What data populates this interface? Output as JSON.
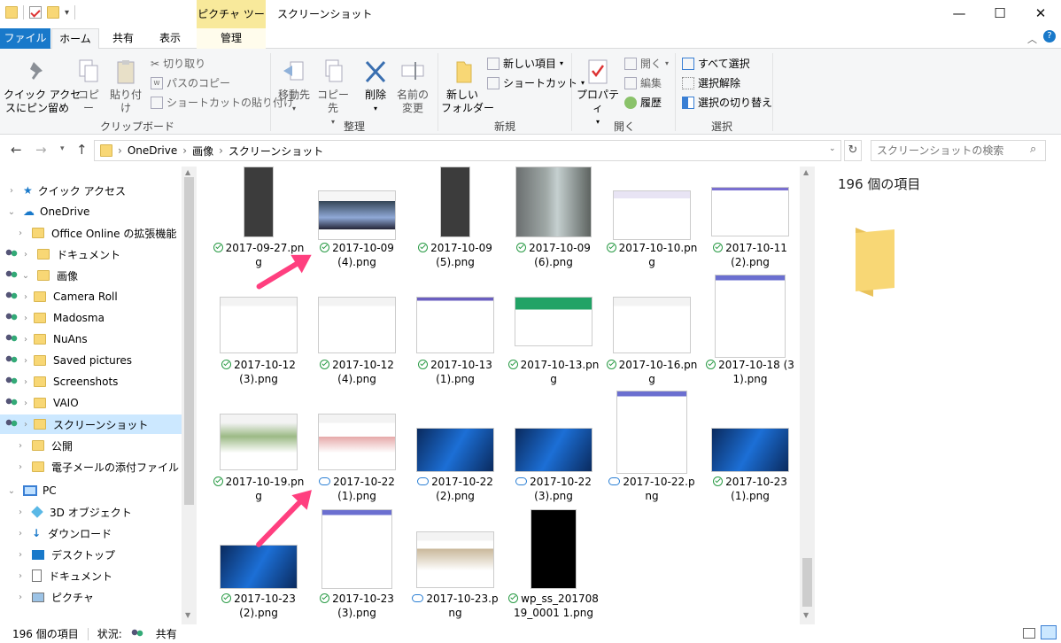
{
  "window": {
    "title": "スクリーンショット",
    "context_tab": "ピクチャ ツール",
    "controls": [
      "—",
      "☐",
      "✕"
    ]
  },
  "tabs": [
    "ファイル",
    "ホーム",
    "共有",
    "表示",
    "管理"
  ],
  "ribbon": {
    "pin": "クイック アクセ\nスにピン留め",
    "copy": "コピー",
    "paste": "貼り付け",
    "cut": "切り取り",
    "copy_path": "パスのコピー",
    "paste_shortcut": "ショートカットの貼り付け",
    "group_clipboard": "クリップボード",
    "move_to": "移動先",
    "copy_to": "コピー先",
    "delete": "削除",
    "rename": "名前の\n変更",
    "group_organize": "整理",
    "new_folder": "新しい\nフォルダー",
    "new_item": "新しい項目",
    "shortcut": "ショートカット",
    "group_new": "新規",
    "properties": "プロパティ",
    "open": "開く",
    "edit": "編集",
    "history": "履歴",
    "group_open": "開く",
    "select_all": "すべて選択",
    "select_none": "選択解除",
    "invert": "選択の切り替え",
    "group_select": "選択"
  },
  "address": {
    "crumbs": [
      "OneDrive",
      "画像",
      "スクリーンショット"
    ],
    "search_placeholder": "スクリーンショットの検索"
  },
  "sidebar": [
    {
      "label": "クイック アクセス",
      "level": 0,
      "chev": "›"
    },
    {
      "label": "OneDrive",
      "level": 0,
      "chev": "⌄"
    },
    {
      "label": "Office Online の拡張機能",
      "level": 1,
      "chev": "›"
    },
    {
      "label": "ドキュメント",
      "level": 1,
      "chev": "›"
    },
    {
      "label": "画像",
      "level": 1,
      "chev": "⌄"
    },
    {
      "label": "Camera Roll",
      "level": 2,
      "chev": "›"
    },
    {
      "label": "Madosma",
      "level": 2,
      "chev": "›"
    },
    {
      "label": "NuAns",
      "level": 2,
      "chev": "›"
    },
    {
      "label": "Saved pictures",
      "level": 2,
      "chev": "›"
    },
    {
      "label": "Screenshots",
      "level": 2,
      "chev": "›"
    },
    {
      "label": "VAIO",
      "level": 2,
      "chev": "›"
    },
    {
      "label": "スクリーンショット",
      "level": 2,
      "chev": "›"
    },
    {
      "label": "公開",
      "level": 1,
      "chev": "›"
    },
    {
      "label": "電子メールの添付ファイル",
      "level": 1,
      "chev": "›"
    },
    {
      "label": "PC",
      "level": 0,
      "chev": "⌄"
    },
    {
      "label": "3D オブジェクト",
      "level": 1,
      "chev": "›"
    },
    {
      "label": "ダウンロード",
      "level": 1,
      "chev": "›"
    },
    {
      "label": "デスクトップ",
      "level": 1,
      "chev": "›"
    },
    {
      "label": "ドキュメント",
      "level": 1,
      "chev": "›"
    },
    {
      "label": "ピクチャ",
      "level": 1,
      "chev": "›"
    }
  ],
  "files": [
    {
      "name": "2017-09-27.png",
      "status": "synced"
    },
    {
      "name": "2017-10-09 (4).png",
      "status": "synced"
    },
    {
      "name": "2017-10-09 (5).png",
      "status": "synced"
    },
    {
      "name": "2017-10-09 (6).png",
      "status": "synced"
    },
    {
      "name": "2017-10-10.png",
      "status": "synced"
    },
    {
      "name": "2017-10-11 (2).png",
      "status": "synced"
    },
    {
      "name": "2017-10-12 (3).png",
      "status": "synced"
    },
    {
      "name": "2017-10-12 (4).png",
      "status": "synced"
    },
    {
      "name": "2017-10-13 (1).png",
      "status": "synced"
    },
    {
      "name": "2017-10-13.png",
      "status": "synced"
    },
    {
      "name": "2017-10-16.png",
      "status": "synced"
    },
    {
      "name": "2017-10-18 (31).png",
      "status": "synced"
    },
    {
      "name": "2017-10-19.png",
      "status": "synced"
    },
    {
      "name": "2017-10-22 (1).png",
      "status": "cloud"
    },
    {
      "name": "2017-10-22 (2).png",
      "status": "cloud"
    },
    {
      "name": "2017-10-22 (3).png",
      "status": "cloud"
    },
    {
      "name": "2017-10-22.png",
      "status": "cloud"
    },
    {
      "name": "2017-10-23 (1).png",
      "status": "synced"
    },
    {
      "name": "2017-10-23 (2).png",
      "status": "synced"
    },
    {
      "name": "2017-10-23 (3).png",
      "status": "synced"
    },
    {
      "name": "2017-10-23.png",
      "status": "cloud"
    },
    {
      "name": "wp_ss_20170819_0001 1.png",
      "status": "synced"
    }
  ],
  "preview": {
    "count": "196 個の項目"
  },
  "status": {
    "count": "196 個の項目",
    "state_label": "状況:",
    "state_value": "共有"
  },
  "colors": {
    "accent": "#1979ca",
    "arrow": "#ff3f7f",
    "selected": "#cce8ff"
  }
}
